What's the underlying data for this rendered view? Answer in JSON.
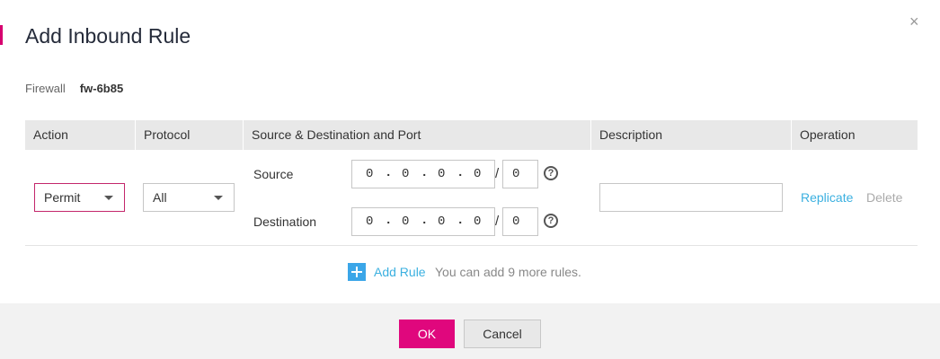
{
  "dialog": {
    "title": "Add Inbound Rule",
    "close_symbol": "×",
    "accent_color": "#d6006f"
  },
  "firewall": {
    "label": "Firewall",
    "value": "fw-6b85"
  },
  "table": {
    "headers": [
      "Action",
      "Protocol",
      "Source & Destination and Port",
      "Description",
      "Operation"
    ],
    "row": {
      "action": "Permit",
      "protocol": "All",
      "source": {
        "label": "Source",
        "octets": [
          "0",
          "0",
          "0",
          "0"
        ],
        "mask": "0"
      },
      "destination": {
        "label": "Destination",
        "octets": [
          "0",
          "0",
          "0",
          "0"
        ],
        "mask": "0"
      },
      "description": "",
      "operations": {
        "replicate": "Replicate",
        "delete": "Delete"
      }
    }
  },
  "add_rule": {
    "label": "Add Rule",
    "hint": "You can add 9 more rules."
  },
  "footer": {
    "ok": "OK",
    "cancel": "Cancel"
  },
  "colors": {
    "primary_button": "#e0077d",
    "link": "#3bb0e0",
    "add_icon": "#3ba6e8"
  }
}
